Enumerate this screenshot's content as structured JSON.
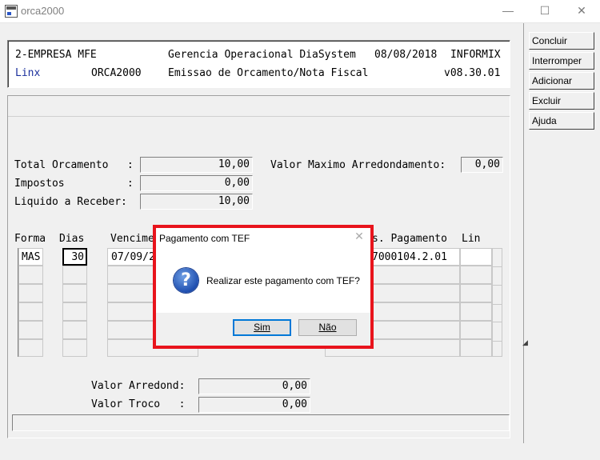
{
  "window": {
    "title": "orca2000",
    "minimize": "—",
    "maximize": "☐",
    "close": "✕"
  },
  "header": {
    "company": "2-EMPRESA MFE",
    "system": "Gerencia Operacional DiaSystem",
    "date": "08/08/2018",
    "db": "INFORMIX",
    "brand": "Linx",
    "program": "ORCA2000",
    "module": "Emissao de Orcamento/Nota Fiscal",
    "version": "v08.30.01"
  },
  "sidebar": {
    "concluir": "Concluir",
    "interromper": "Interromper",
    "adicionar": "Adicionar",
    "excluir": "Excluir",
    "ajuda": "Ajuda"
  },
  "totals": {
    "total_label": "Total Orcamento   :",
    "total_value": "10,00",
    "impostos_label": "Impostos          :",
    "impostos_value": "0,00",
    "liquido_label": "Liquido a Receber:",
    "liquido_value": "10,00",
    "max_arred_label": "Valor Maximo Arredondamento:",
    "max_arred_value": "0,00"
  },
  "grid": {
    "col_forma": "Forma",
    "col_dias": "Dias",
    "col_venc": "Vencime",
    "col_pag": "s. Pagamento",
    "col_lin": "Lin",
    "row1_forma": "MAS",
    "row1_dias": "30",
    "row1_venc": "07/09/2",
    "row1_pag": "7000104.2.01"
  },
  "footer": {
    "arred_label": "Valor Arredond:",
    "arred_value": "0,00",
    "troco_label": "Valor Troco   :",
    "troco_value": "0,00"
  },
  "dialog": {
    "title": "Pagamento com TEF",
    "message": "Realizar este pagamento com TEF?",
    "yes": "Sim",
    "no": "Não",
    "icon": "question-icon"
  }
}
